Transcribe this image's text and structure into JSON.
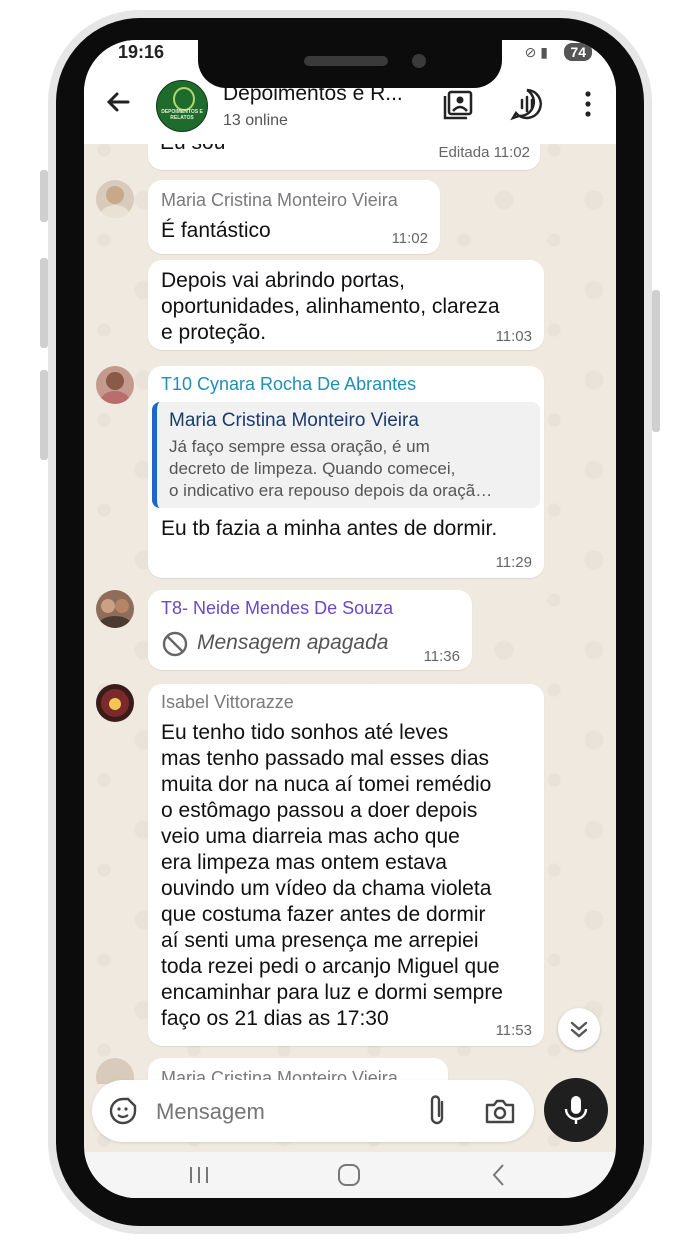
{
  "status_bar": {
    "time": "19:16",
    "battery": "74",
    "signal_icons": "⊘ ▮"
  },
  "header": {
    "group_name": "Depoimentos e R...",
    "subtitle": "13 online",
    "avatar_text": "DEPOIMENTOS E RELATOS"
  },
  "messages": [
    {
      "partial_text": "Eu sou",
      "time": "Editada 11:02"
    },
    {
      "sender": "Maria Cristina Monteiro Vieira",
      "sender_color": "#7a7a7a",
      "text": "É fantástico",
      "time": "11:02"
    },
    {
      "text_lines": [
        "Depois vai abrindo portas,",
        "oportunidades, alinhamento, clareza",
        "e proteção."
      ],
      "time": "11:03"
    },
    {
      "sender": "T10 Cynara Rocha De Abrantes",
      "sender_color": "#1e8fb5",
      "quote": {
        "author": "Maria Cristina Monteiro Vieira",
        "lines": [
          "Já faço sempre essa oração, é um",
          "decreto de limpeza. Quando comecei,",
          "o indicativo era repouso depois da oraçã…"
        ]
      },
      "text": "Eu tb fazia a minha antes de dormir.",
      "time": "11:29"
    },
    {
      "sender": "T8- Neide Mendes De Souza",
      "sender_color": "#6a49c4",
      "deleted_text": "Mensagem apagada",
      "time": "11:36"
    },
    {
      "sender": "Isabel Vittorazze",
      "sender_color": "#7a7a7a",
      "text_lines": [
        "Eu tenho tido sonhos até leves",
        "mas tenho passado mal esses dias",
        "muita dor na nuca aí tomei remédio",
        "o estômago passou a doer depois",
        "veio uma diarreia mas acho que",
        "era limpeza mas ontem estava",
        "ouvindo um vídeo da chama violeta",
        "que costuma fazer antes de dormir",
        "aí senti uma presença me arrepiei",
        "toda rezei pedi o arcanjo Miguel que",
        "encaminhar para luz e dormi sempre",
        "faço os 21 dias as 17:30"
      ],
      "time": "11:53"
    },
    {
      "partial_sender": "Maria Cristina Monteiro Vieira"
    }
  ],
  "composer": {
    "placeholder": "Mensagem"
  },
  "colors": {
    "accent_green": "#1e6b2e",
    "quote_bar": "#1f66c9",
    "chat_bg": "#efe9df"
  }
}
